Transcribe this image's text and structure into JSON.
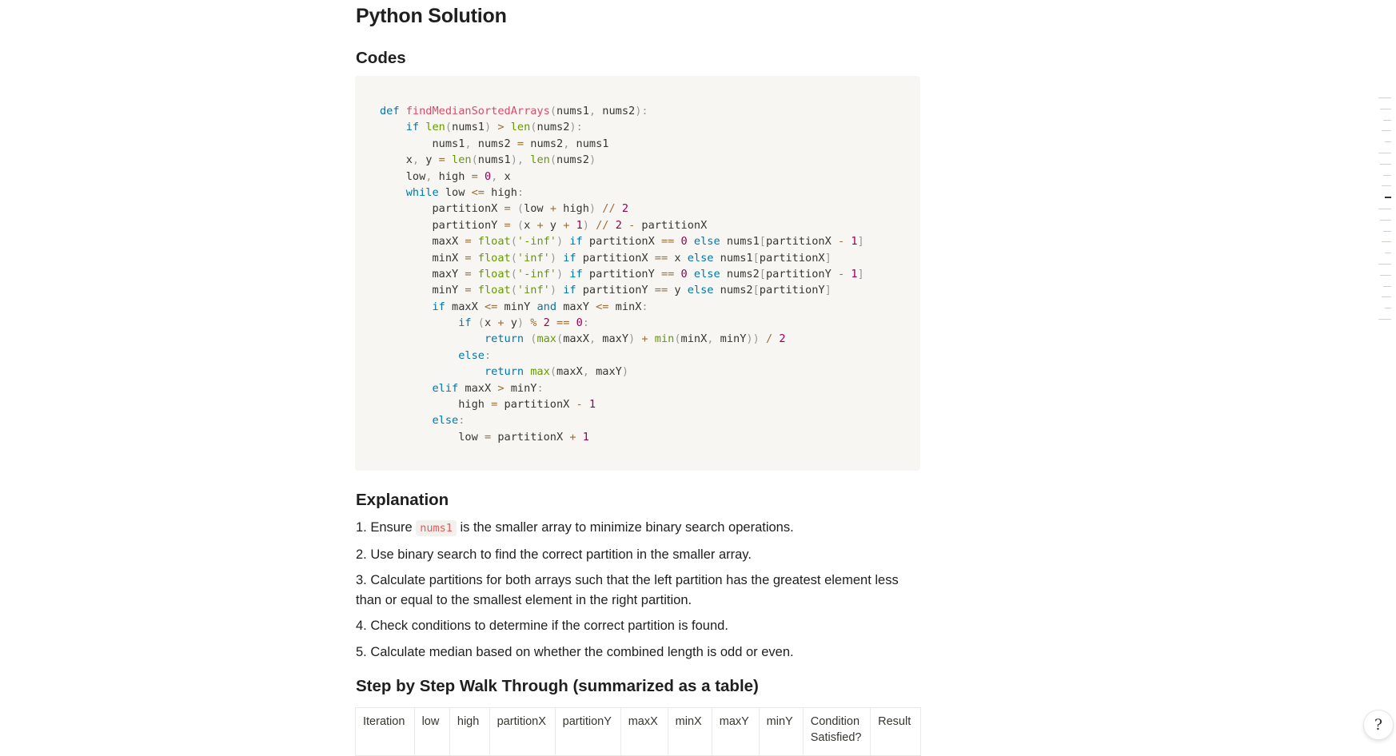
{
  "page": {
    "title": "Python Solution",
    "codes_heading": "Codes",
    "explanation_heading": "Explanation",
    "walkthrough_heading": "Step by Step Walk Through (summarized as a table)"
  },
  "code": {
    "language": "python",
    "lines": [
      "def findMedianSortedArrays(nums1, nums2):",
      "    if len(nums1) > len(nums2):",
      "        nums1, nums2 = nums2, nums1",
      "    x, y = len(nums1), len(nums2)",
      "    low, high = 0, x",
      "    while low <= high:",
      "        partitionX = (low + high) // 2",
      "        partitionY = (x + y + 1) // 2 - partitionX",
      "        maxX = float('-inf') if partitionX == 0 else nums1[partitionX - 1]",
      "        minX = float('inf') if partitionX == x else nums1[partitionX]",
      "        maxY = float('-inf') if partitionY == 0 else nums2[partitionY - 1]",
      "        minY = float('inf') if partitionY == y else nums2[partitionY]",
      "        if maxX <= minY and maxY <= minX:",
      "            if (x + y) % 2 == 0:",
      "                return (max(maxX, maxY) + min(minX, minY)) / 2",
      "            else:",
      "                return max(maxX, maxY)",
      "        elif maxX > minY:",
      "            high = partitionX - 1",
      "        else:",
      "            low = partitionX + 1"
    ]
  },
  "explanation": {
    "step1_prefix": "1. Ensure ",
    "step1_code": "nums1",
    "step1_suffix": " is the smaller array to minimize binary search operations.",
    "step2": "2. Use binary search to find the correct partition in the smaller array.",
    "step3": "3. Calculate partitions for both arrays such that the left partition has the greatest element less than or equal to the smallest element in the right partition.",
    "step4": "4. Check conditions to determine if the correct partition is found.",
    "step5": "5. Calculate median based on whether the combined length is odd or even."
  },
  "table": {
    "headers": [
      "Iteration",
      "low",
      "high",
      "partitionX",
      "partitionY",
      "maxX",
      "minX",
      "maxY",
      "minY",
      "Condition Satisfied?",
      "Result"
    ]
  },
  "icons": {
    "help": "help-icon"
  },
  "colors": {
    "keyword": "#0077aa",
    "function_name": "#dd4a68",
    "builtin": "#669900",
    "number": "#990055",
    "inline_code": "#eb5757",
    "code_bg": "#f7f6f3"
  }
}
